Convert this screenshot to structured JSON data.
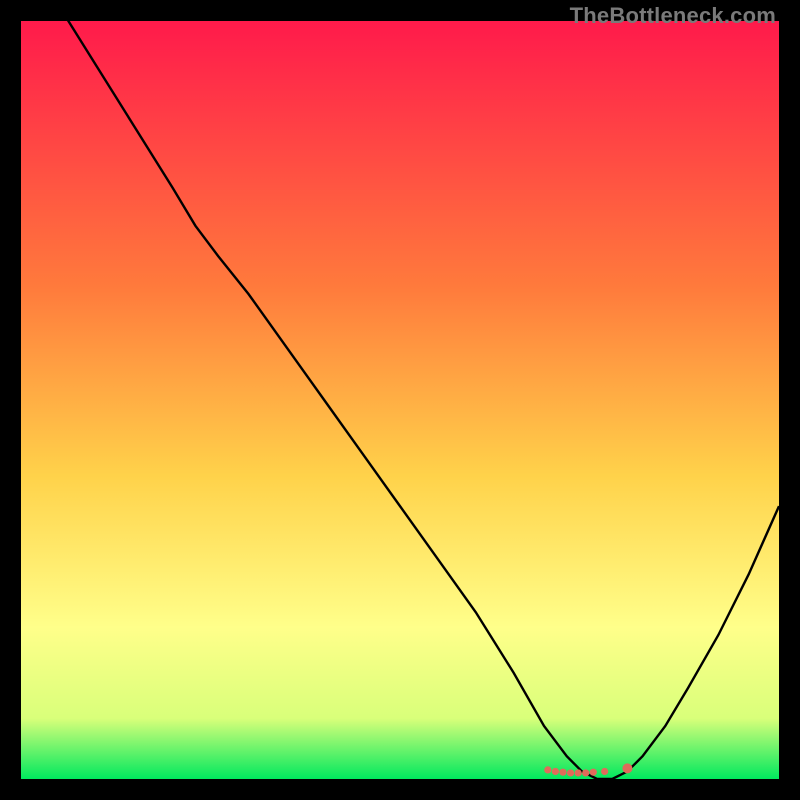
{
  "watermark": "TheBottleneck.com",
  "colors": {
    "gradient_top": "#ff1a4b",
    "gradient_mid1": "#ff7a3c",
    "gradient_mid2": "#ffd24a",
    "gradient_mid3": "#ffff8a",
    "gradient_mid4": "#d9ff7a",
    "gradient_bottom": "#00e85e",
    "curve": "#000000",
    "markers": "#e06b5a"
  },
  "chart_data": {
    "type": "line",
    "title": "",
    "xlabel": "",
    "ylabel": "",
    "xlim": [
      0,
      100
    ],
    "ylim": [
      0,
      100
    ],
    "series": [
      {
        "name": "bottleneck-curve",
        "x": [
          0,
          5,
          10,
          15,
          20,
          23,
          26,
          30,
          35,
          40,
          45,
          50,
          55,
          60,
          65,
          69,
          72,
          74,
          76,
          78,
          80,
          82,
          85,
          88,
          92,
          96,
          100
        ],
        "y": [
          110,
          102,
          94,
          86,
          78,
          73,
          69,
          64,
          57,
          50,
          43,
          36,
          29,
          22,
          14,
          7,
          3,
          1,
          0,
          0,
          1,
          3,
          7,
          12,
          19,
          27,
          36
        ]
      }
    ],
    "markers": {
      "name": "highlight-points",
      "x": [
        69.5,
        70.5,
        71.5,
        72.5,
        73.5,
        74.5,
        75.5,
        77.0,
        80.0
      ],
      "y": [
        1.2,
        1.0,
        0.9,
        0.8,
        0.8,
        0.8,
        0.9,
        1.0,
        1.4
      ]
    }
  }
}
